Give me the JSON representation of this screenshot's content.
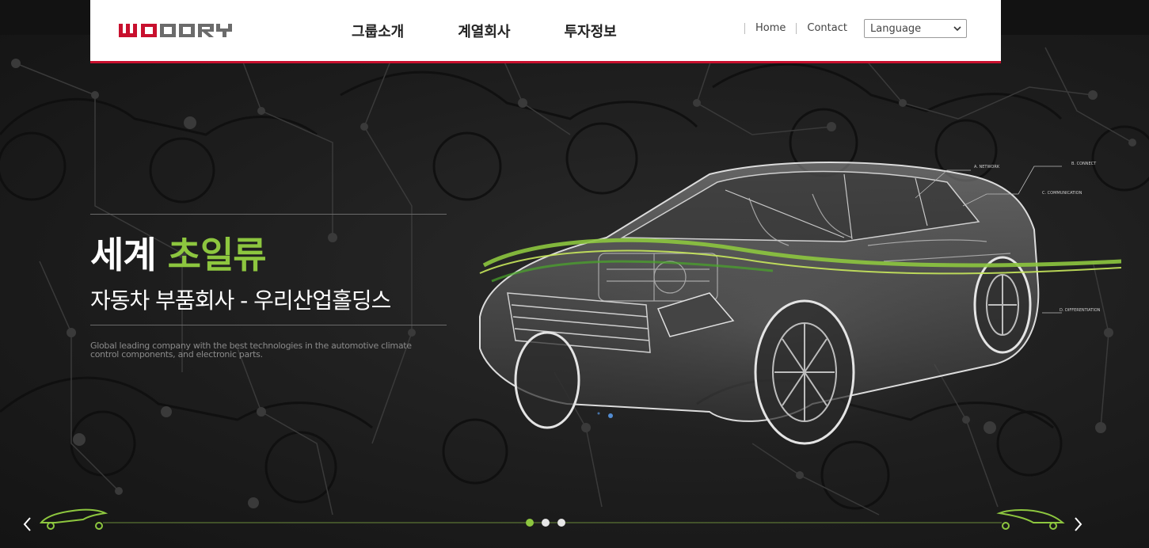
{
  "header": {
    "logo_text": "WOORY",
    "nav": [
      "그룹소개",
      "계열회사",
      "투자정보"
    ],
    "util_links": [
      "Home",
      "Contact"
    ],
    "language_select": "Language"
  },
  "hero": {
    "title_plain": "세계 ",
    "title_accent": "초일류",
    "subtitle": "자동차 부품회사 - 우리산업홀딩스",
    "description": "Global leading company with the best technologies in the automotive climate control components, and electronic parts.",
    "hud_labels": [
      "A. NETWORK",
      "B. CONNECT",
      "C. COMMUNICATION",
      "D. DIFFERENTIATION"
    ]
  },
  "slider": {
    "dots": [
      true,
      false,
      false
    ],
    "prev_icon": "chevron-left-icon",
    "next_icon": "chevron-right-icon"
  },
  "colors": {
    "brand_red": "#c8102e",
    "accent_green": "#8dc63f",
    "background": "#1d1d1d"
  }
}
